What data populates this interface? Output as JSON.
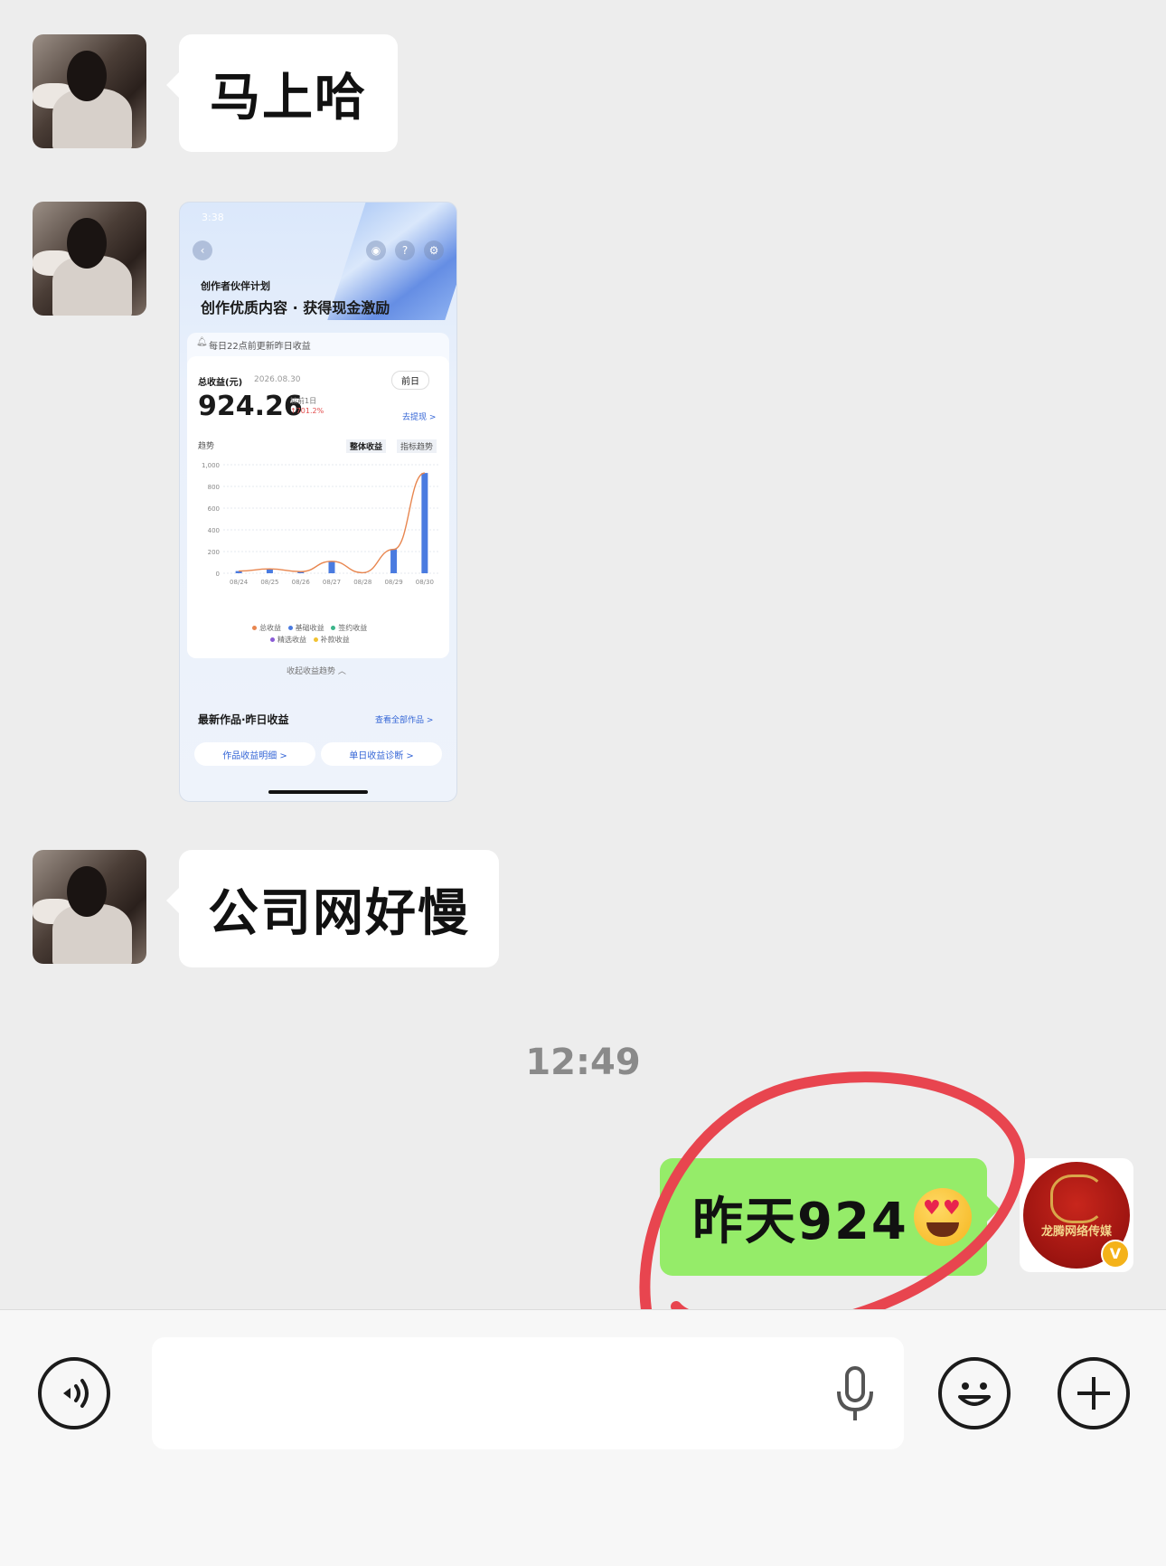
{
  "messages": [
    {
      "type": "text",
      "side": "left",
      "text": "马上哈"
    },
    {
      "type": "image",
      "side": "left"
    },
    {
      "type": "text",
      "side": "left",
      "text": "公司网好慢"
    },
    {
      "type": "time",
      "text": "12:49"
    },
    {
      "type": "text",
      "side": "right",
      "text": "昨天924",
      "emoji": "heart-eyes-emoji"
    }
  ],
  "screenshot": {
    "status_time": "3:38",
    "program": "创作者伙伴计划",
    "slogan": "创作优质内容 · 获得现金激励",
    "notice": "每日22点前更新昨日收益",
    "total_label": "总收益(元)",
    "date": "2026.08.30",
    "period": "前日",
    "amount": "924.26",
    "compare_label": "较前1日",
    "compare_value": "↑701.2%",
    "withdraw": "去提现 >",
    "trend_label": "趋势",
    "tab1": "整体收益",
    "tab2": "指标趋势",
    "collapse": "收起收益趋势 ︿",
    "latest_works": "最新作品·昨日收益",
    "view_all": "查看全部作品 >",
    "btn1": "作品收益明细 >",
    "btn2": "单日收益诊断 >"
  },
  "chart_data": {
    "type": "bar",
    "categories": [
      "08/24",
      "08/25",
      "08/26",
      "08/27",
      "08/28",
      "08/29",
      "08/30"
    ],
    "series": [
      {
        "name": "总收益",
        "values": [
          20,
          40,
          15,
          110,
          5,
          220,
          924
        ]
      }
    ],
    "ylim": [
      0,
      1000
    ],
    "yticks": [
      "1,000",
      "800",
      "600",
      "400",
      "200",
      "0"
    ],
    "legend": [
      "总收益",
      "基础收益",
      "签约收益",
      "精选收益",
      "补款收益"
    ],
    "colors": {
      "bar": "#4a7be0",
      "line": "#e8864f"
    }
  },
  "contact_badge": "V",
  "logo_caption": "龙腾网络传媒",
  "colors": {
    "sent_bubble": "#95ec69",
    "highlight_circle": "#e8454f"
  },
  "inputbar": {
    "voice_icon": "voice-mode-icon",
    "mic_icon": "microphone-icon",
    "emoji_icon": "emoji-icon",
    "plus_icon": "plus-icon"
  }
}
